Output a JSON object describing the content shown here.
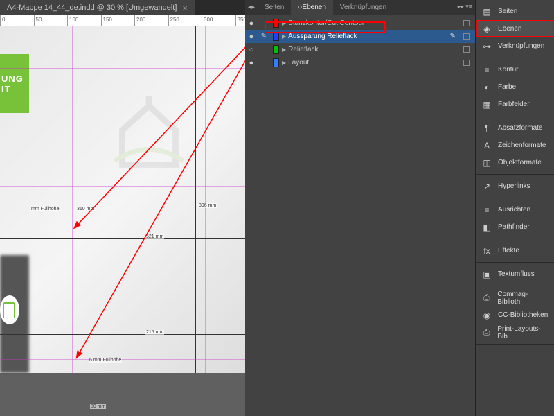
{
  "document": {
    "tab_title": "A4-Mappe 14_44_de.indd @ 30 % [Umgewandelt]",
    "ruler_ticks": [
      0,
      50,
      100,
      150,
      200,
      250,
      300,
      350
    ]
  },
  "measurements": {
    "fill_left": "mm Füllhöhe",
    "m310": "310 mm",
    "m396": "396 mm",
    "m521": "521 mm",
    "m215": "215 mm",
    "fill6": "6 mm Füllhöhe",
    "m80": "80 mm"
  },
  "greenbox_lines": [
    "UNG",
    "IT"
  ],
  "panel_tabs": {
    "seiten": "Seiten",
    "ebenen": "Ebenen",
    "verkn": "Verknüpfungen"
  },
  "layers": [
    {
      "name": "Stanzkontur/Cut Contour",
      "color": "#ff0000",
      "selected": false
    },
    {
      "name": "Aussparung Relieflack",
      "color": "#2040ff",
      "selected": true,
      "pen": true
    },
    {
      "name": "Relieflack",
      "color": "#00c000",
      "selected": false
    },
    {
      "name": "Layout",
      "color": "#3080ff",
      "selected": false
    }
  ],
  "rail_groups": [
    [
      {
        "name": "Seiten",
        "icon": "▤"
      },
      {
        "name": "Ebenen",
        "icon": "◈",
        "hl": true
      },
      {
        "name": "Verknüpfungen",
        "icon": "⊶"
      }
    ],
    [
      {
        "name": "Kontur",
        "icon": "≡"
      },
      {
        "name": "Farbe",
        "icon": "◐"
      },
      {
        "name": "Farbfelder",
        "icon": "▦"
      }
    ],
    [
      {
        "name": "Absatzformate",
        "icon": "¶"
      },
      {
        "name": "Zeichenformate",
        "icon": "A"
      },
      {
        "name": "Objektformate",
        "icon": "◫"
      }
    ],
    [
      {
        "name": "Hyperlinks",
        "icon": "↗"
      }
    ],
    [
      {
        "name": "Ausrichten",
        "icon": "≡"
      },
      {
        "name": "Pathfinder",
        "icon": "◧"
      }
    ],
    [
      {
        "name": "Effekte",
        "icon": "fx"
      }
    ],
    [
      {
        "name": "Textumfluss",
        "icon": "▣"
      }
    ],
    [
      {
        "name": "Commag-Biblioth",
        "icon": "⎙"
      },
      {
        "name": "CC-Bibliotheken",
        "icon": "◉"
      },
      {
        "name": "Print-Layouts-Bib",
        "icon": "⎙"
      }
    ]
  ]
}
